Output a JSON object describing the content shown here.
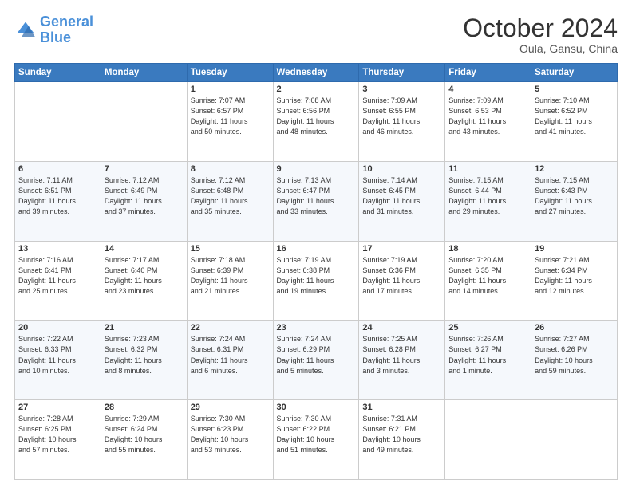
{
  "header": {
    "logo_line1": "General",
    "logo_line2": "Blue",
    "month": "October 2024",
    "location": "Oula, Gansu, China"
  },
  "weekdays": [
    "Sunday",
    "Monday",
    "Tuesday",
    "Wednesday",
    "Thursday",
    "Friday",
    "Saturday"
  ],
  "weeks": [
    [
      {
        "day": "",
        "lines": []
      },
      {
        "day": "",
        "lines": []
      },
      {
        "day": "1",
        "lines": [
          "Sunrise: 7:07 AM",
          "Sunset: 6:57 PM",
          "Daylight: 11 hours",
          "and 50 minutes."
        ]
      },
      {
        "day": "2",
        "lines": [
          "Sunrise: 7:08 AM",
          "Sunset: 6:56 PM",
          "Daylight: 11 hours",
          "and 48 minutes."
        ]
      },
      {
        "day": "3",
        "lines": [
          "Sunrise: 7:09 AM",
          "Sunset: 6:55 PM",
          "Daylight: 11 hours",
          "and 46 minutes."
        ]
      },
      {
        "day": "4",
        "lines": [
          "Sunrise: 7:09 AM",
          "Sunset: 6:53 PM",
          "Daylight: 11 hours",
          "and 43 minutes."
        ]
      },
      {
        "day": "5",
        "lines": [
          "Sunrise: 7:10 AM",
          "Sunset: 6:52 PM",
          "Daylight: 11 hours",
          "and 41 minutes."
        ]
      }
    ],
    [
      {
        "day": "6",
        "lines": [
          "Sunrise: 7:11 AM",
          "Sunset: 6:51 PM",
          "Daylight: 11 hours",
          "and 39 minutes."
        ]
      },
      {
        "day": "7",
        "lines": [
          "Sunrise: 7:12 AM",
          "Sunset: 6:49 PM",
          "Daylight: 11 hours",
          "and 37 minutes."
        ]
      },
      {
        "day": "8",
        "lines": [
          "Sunrise: 7:12 AM",
          "Sunset: 6:48 PM",
          "Daylight: 11 hours",
          "and 35 minutes."
        ]
      },
      {
        "day": "9",
        "lines": [
          "Sunrise: 7:13 AM",
          "Sunset: 6:47 PM",
          "Daylight: 11 hours",
          "and 33 minutes."
        ]
      },
      {
        "day": "10",
        "lines": [
          "Sunrise: 7:14 AM",
          "Sunset: 6:45 PM",
          "Daylight: 11 hours",
          "and 31 minutes."
        ]
      },
      {
        "day": "11",
        "lines": [
          "Sunrise: 7:15 AM",
          "Sunset: 6:44 PM",
          "Daylight: 11 hours",
          "and 29 minutes."
        ]
      },
      {
        "day": "12",
        "lines": [
          "Sunrise: 7:15 AM",
          "Sunset: 6:43 PM",
          "Daylight: 11 hours",
          "and 27 minutes."
        ]
      }
    ],
    [
      {
        "day": "13",
        "lines": [
          "Sunrise: 7:16 AM",
          "Sunset: 6:41 PM",
          "Daylight: 11 hours",
          "and 25 minutes."
        ]
      },
      {
        "day": "14",
        "lines": [
          "Sunrise: 7:17 AM",
          "Sunset: 6:40 PM",
          "Daylight: 11 hours",
          "and 23 minutes."
        ]
      },
      {
        "day": "15",
        "lines": [
          "Sunrise: 7:18 AM",
          "Sunset: 6:39 PM",
          "Daylight: 11 hours",
          "and 21 minutes."
        ]
      },
      {
        "day": "16",
        "lines": [
          "Sunrise: 7:19 AM",
          "Sunset: 6:38 PM",
          "Daylight: 11 hours",
          "and 19 minutes."
        ]
      },
      {
        "day": "17",
        "lines": [
          "Sunrise: 7:19 AM",
          "Sunset: 6:36 PM",
          "Daylight: 11 hours",
          "and 17 minutes."
        ]
      },
      {
        "day": "18",
        "lines": [
          "Sunrise: 7:20 AM",
          "Sunset: 6:35 PM",
          "Daylight: 11 hours",
          "and 14 minutes."
        ]
      },
      {
        "day": "19",
        "lines": [
          "Sunrise: 7:21 AM",
          "Sunset: 6:34 PM",
          "Daylight: 11 hours",
          "and 12 minutes."
        ]
      }
    ],
    [
      {
        "day": "20",
        "lines": [
          "Sunrise: 7:22 AM",
          "Sunset: 6:33 PM",
          "Daylight: 11 hours",
          "and 10 minutes."
        ]
      },
      {
        "day": "21",
        "lines": [
          "Sunrise: 7:23 AM",
          "Sunset: 6:32 PM",
          "Daylight: 11 hours",
          "and 8 minutes."
        ]
      },
      {
        "day": "22",
        "lines": [
          "Sunrise: 7:24 AM",
          "Sunset: 6:31 PM",
          "Daylight: 11 hours",
          "and 6 minutes."
        ]
      },
      {
        "day": "23",
        "lines": [
          "Sunrise: 7:24 AM",
          "Sunset: 6:29 PM",
          "Daylight: 11 hours",
          "and 5 minutes."
        ]
      },
      {
        "day": "24",
        "lines": [
          "Sunrise: 7:25 AM",
          "Sunset: 6:28 PM",
          "Daylight: 11 hours",
          "and 3 minutes."
        ]
      },
      {
        "day": "25",
        "lines": [
          "Sunrise: 7:26 AM",
          "Sunset: 6:27 PM",
          "Daylight: 11 hours",
          "and 1 minute."
        ]
      },
      {
        "day": "26",
        "lines": [
          "Sunrise: 7:27 AM",
          "Sunset: 6:26 PM",
          "Daylight: 10 hours",
          "and 59 minutes."
        ]
      }
    ],
    [
      {
        "day": "27",
        "lines": [
          "Sunrise: 7:28 AM",
          "Sunset: 6:25 PM",
          "Daylight: 10 hours",
          "and 57 minutes."
        ]
      },
      {
        "day": "28",
        "lines": [
          "Sunrise: 7:29 AM",
          "Sunset: 6:24 PM",
          "Daylight: 10 hours",
          "and 55 minutes."
        ]
      },
      {
        "day": "29",
        "lines": [
          "Sunrise: 7:30 AM",
          "Sunset: 6:23 PM",
          "Daylight: 10 hours",
          "and 53 minutes."
        ]
      },
      {
        "day": "30",
        "lines": [
          "Sunrise: 7:30 AM",
          "Sunset: 6:22 PM",
          "Daylight: 10 hours",
          "and 51 minutes."
        ]
      },
      {
        "day": "31",
        "lines": [
          "Sunrise: 7:31 AM",
          "Sunset: 6:21 PM",
          "Daylight: 10 hours",
          "and 49 minutes."
        ]
      },
      {
        "day": "",
        "lines": []
      },
      {
        "day": "",
        "lines": []
      }
    ]
  ]
}
